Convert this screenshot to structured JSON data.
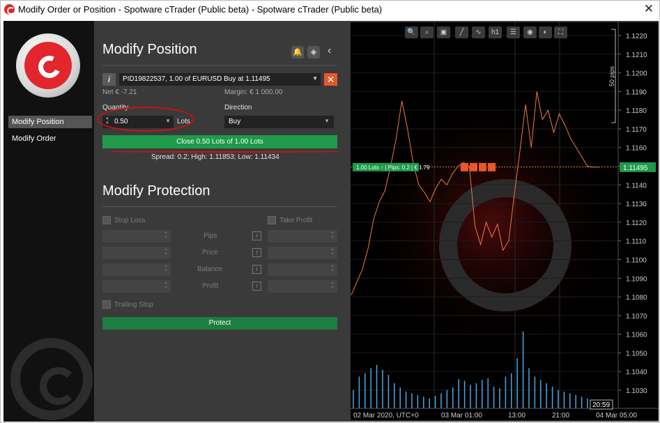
{
  "window": {
    "title": "Modify Order or Position - Spotware cTrader (Public beta) - Spotware cTrader (Public beta)",
    "close_glyph": "✕"
  },
  "sidebar": {
    "items": [
      {
        "label": "Modify Position",
        "active": true
      },
      {
        "label": "Modify Order",
        "active": false
      }
    ]
  },
  "modify_position": {
    "title": "Modify Position",
    "icons": [
      "bell-icon",
      "shield-icon",
      "chevron-left-icon"
    ],
    "position_select": "PID19822537, 1.00 of EURUSD Buy at 1.11495",
    "net": "Net € -7.21",
    "margin": "Margin: € 1 000.00",
    "quantity_label": "Quantity",
    "quantity_value": "0.50",
    "lots_label": "Lots",
    "direction_label": "Direction",
    "direction_value": "Buy",
    "close_button": "Close 0.50 Lots of 1.00 Lots",
    "spread_info": "Spread: 0.2; High: 1.11853; Low: 1.11434"
  },
  "modify_protection": {
    "title": "Modify Protection",
    "stop_loss": "Stop Loss",
    "take_profit": "Take Profit",
    "rows": [
      "Pips",
      "Price",
      "Balance",
      "Profit"
    ],
    "trailing_stop": "Trailing Stop",
    "protect_button": "Protect"
  },
  "colors": {
    "accent_green": "#1e9a4a",
    "close_orange": "#e8572a",
    "price_line": "#f07a40",
    "volume": "#4aa8e8",
    "annotation": "#d01010"
  },
  "chart": {
    "toolbar": [
      "zoom-out-icon",
      "zoom-in-icon",
      "screenshot-icon",
      "draw-icon",
      "indicator-icon",
      "h1",
      "list-icon",
      "watch-icon",
      "theme-icon",
      "share-icon"
    ],
    "scale_label": "50 pips",
    "position_tag": "1.00 Lots ↑ | Pips: 0.2 | € 1.79",
    "current_price": "1.11495",
    "time_cursor": "20:59",
    "price_ticks": [
      "1.1220",
      "1.1210",
      "1.1200",
      "1.1190",
      "1.1180",
      "1.1170",
      "1.1160",
      "1.1150",
      "1.1140",
      "1.1130",
      "1.1120",
      "1.1110",
      "1.1100",
      "1.1090",
      "1.1080",
      "1.1070",
      "1.1060",
      "1.1050",
      "1.1040",
      "1.1030"
    ],
    "time_ticks": [
      "02 Mar 2020, UTC+0",
      "03 Mar 01:00",
      "13:00",
      "21:00",
      "04 Mar 05:00"
    ]
  },
  "chart_data": {
    "type": "line",
    "ylim": [
      1.1025,
      1.1225
    ],
    "series": [
      {
        "values": [
          1.1081,
          1.1088,
          1.1095,
          1.1106,
          1.1122,
          1.1131,
          1.1137,
          1.115,
          1.1165,
          1.1185,
          1.117,
          1.1152,
          1.114,
          1.1136,
          1.1131,
          1.1138,
          1.1143,
          1.114,
          1.1146,
          1.115,
          1.1152,
          1.115,
          1.1118,
          1.1108,
          1.112,
          1.1112,
          1.1119,
          1.1105,
          1.111,
          1.1135,
          1.1158,
          1.1183,
          1.116,
          1.119,
          1.1175,
          1.118,
          1.1168,
          1.1178,
          1.1172,
          1.1165,
          1.116,
          1.1155,
          1.115,
          1.11495,
          1.11495
        ]
      }
    ],
    "volume": [
      22,
      38,
      42,
      48,
      52,
      46,
      40,
      30,
      25,
      20,
      18,
      16,
      14,
      12,
      15,
      18,
      22,
      25,
      35,
      33,
      28,
      30,
      34,
      36,
      26,
      24,
      38,
      42,
      60,
      92,
      48,
      38,
      34,
      30,
      26,
      22,
      20,
      18,
      16,
      14,
      12,
      10,
      8,
      6,
      5
    ]
  }
}
